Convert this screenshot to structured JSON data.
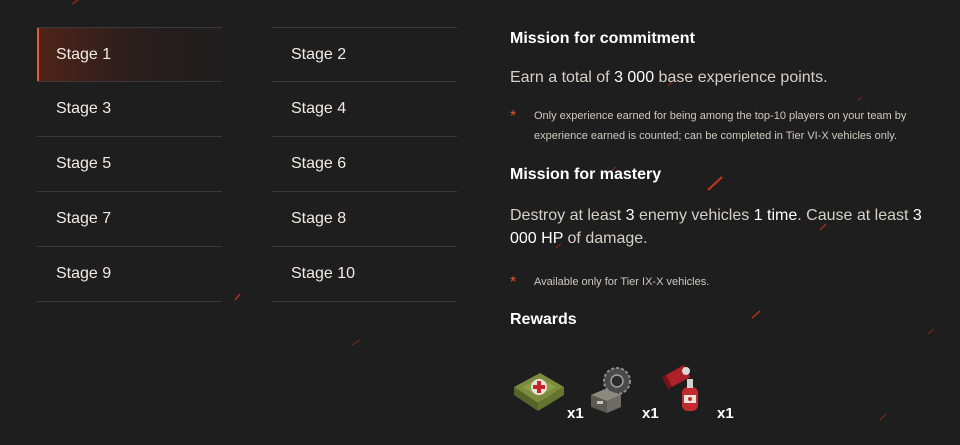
{
  "stages": {
    "left": [
      "Stage 1",
      "Stage 3",
      "Stage 5",
      "Stage 7",
      "Stage 9"
    ],
    "right": [
      "Stage 2",
      "Stage 4",
      "Stage 6",
      "Stage 8",
      "Stage 10"
    ],
    "active": "Stage 1"
  },
  "commitment": {
    "title": "Mission for commitment",
    "desc_prefix": "Earn a total of ",
    "desc_value": "3 000",
    "desc_suffix": " base experience points.",
    "note": "Only experience earned for being among the top-10 players on your team by experience earned is counted; can be completed in Tier VI-X vehicles only."
  },
  "mastery": {
    "title": "Mission for mastery",
    "desc_1": "Destroy at least ",
    "desc_2": "3",
    "desc_3": " enemy vehicles ",
    "desc_4": "1 time",
    "desc_5": ". Cause at least ",
    "desc_6": "3 000 HP",
    "desc_7": " of damage.",
    "note": "Available only for Tier IX-X vehicles."
  },
  "rewards": {
    "title": "Rewards",
    "items": [
      {
        "icon": "first-aid-kit-icon",
        "count": "x1"
      },
      {
        "icon": "equipment-crate-icon",
        "count": "x1"
      },
      {
        "icon": "fire-extinguisher-icon",
        "count": "x1"
      }
    ]
  },
  "colors": {
    "background": "#1f1e1e",
    "accent": "#e55a2e",
    "asterisk": "#e4532a"
  }
}
